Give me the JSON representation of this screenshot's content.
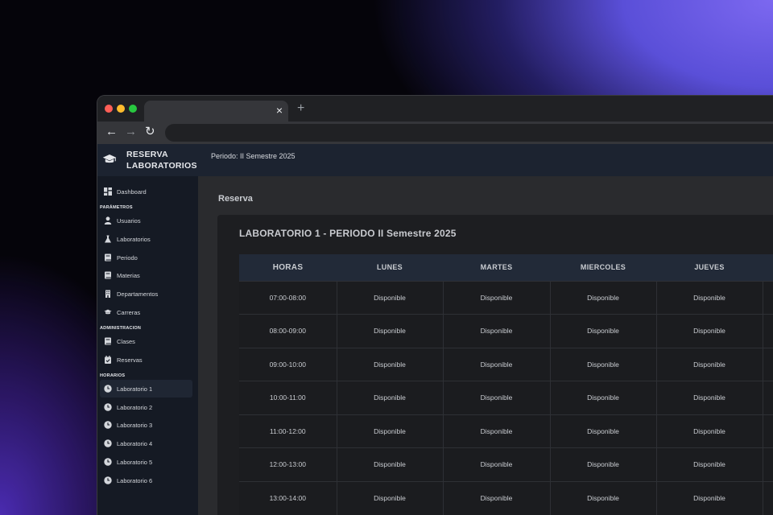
{
  "browser": {
    "tab_close": "×",
    "new_tab": "+",
    "back": "←",
    "forward": "→",
    "reload": "↻",
    "url": ""
  },
  "brand": {
    "line1": "RESERVA",
    "line2": "LABORATORIOS"
  },
  "topbar": {
    "periodo": "Periodo: II Semestre 2025"
  },
  "sidebar": {
    "items": [
      {
        "label": "Dashboard",
        "icon": "dashboard-icon"
      }
    ],
    "sections": [
      {
        "title": "PARÁMETROS",
        "items": [
          {
            "label": "Usuarios",
            "icon": "user-icon"
          },
          {
            "label": "Laboratorios",
            "icon": "flask-icon"
          },
          {
            "label": "Periodo",
            "icon": "book-icon"
          },
          {
            "label": "Materias",
            "icon": "book-icon"
          },
          {
            "label": "Departamentos",
            "icon": "building-icon"
          },
          {
            "label": "Carreras",
            "icon": "graduation-cap-icon"
          }
        ]
      },
      {
        "title": "ADMINISTRACION",
        "items": [
          {
            "label": "Clases",
            "icon": "book-icon"
          },
          {
            "label": "Reservas",
            "icon": "calendar-check-icon"
          }
        ]
      },
      {
        "title": "HORARIOS",
        "items": [
          {
            "label": "Laboratorio 1",
            "icon": "clock-icon",
            "active": true
          },
          {
            "label": "Laboratorio 2",
            "icon": "clock-icon"
          },
          {
            "label": "Laboratorio 3",
            "icon": "clock-icon"
          },
          {
            "label": "Laboratorio 4",
            "icon": "clock-icon"
          },
          {
            "label": "Laboratorio 5",
            "icon": "clock-icon"
          },
          {
            "label": "Laboratorio 6",
            "icon": "clock-icon"
          }
        ]
      }
    ]
  },
  "main": {
    "title": "Reserva",
    "card_title": "LABORATORIO 1 - PERIODO II Semestre 2025",
    "table": {
      "headers": [
        "HORAS",
        "LUNES",
        "MARTES",
        "MIERCOLES",
        "JUEVES",
        ""
      ],
      "rows": [
        [
          "07:00-08:00",
          "Disponible",
          "Disponible",
          "Disponible",
          "Disponible",
          ""
        ],
        [
          "08:00-09:00",
          "Disponible",
          "Disponible",
          "Disponible",
          "Disponible",
          ""
        ],
        [
          "09:00-10:00",
          "Disponible",
          "Disponible",
          "Disponible",
          "Disponible",
          ""
        ],
        [
          "10:00-11:00",
          "Disponible",
          "Disponible",
          "Disponible",
          "Disponible",
          ""
        ],
        [
          "11:00-12:00",
          "Disponible",
          "Disponible",
          "Disponible",
          "Disponible",
          ""
        ],
        [
          "12:00-13:00",
          "Disponible",
          "Disponible",
          "Disponible",
          "Disponible",
          ""
        ],
        [
          "13:00-14:00",
          "Disponible",
          "Disponible",
          "Disponible",
          "Disponible",
          ""
        ]
      ]
    }
  },
  "colors": {
    "sidebar_bg": "#151a24",
    "topbar_bg": "#1c2330",
    "table_header_bg": "#222a38",
    "card_bg": "#1d1e21"
  }
}
